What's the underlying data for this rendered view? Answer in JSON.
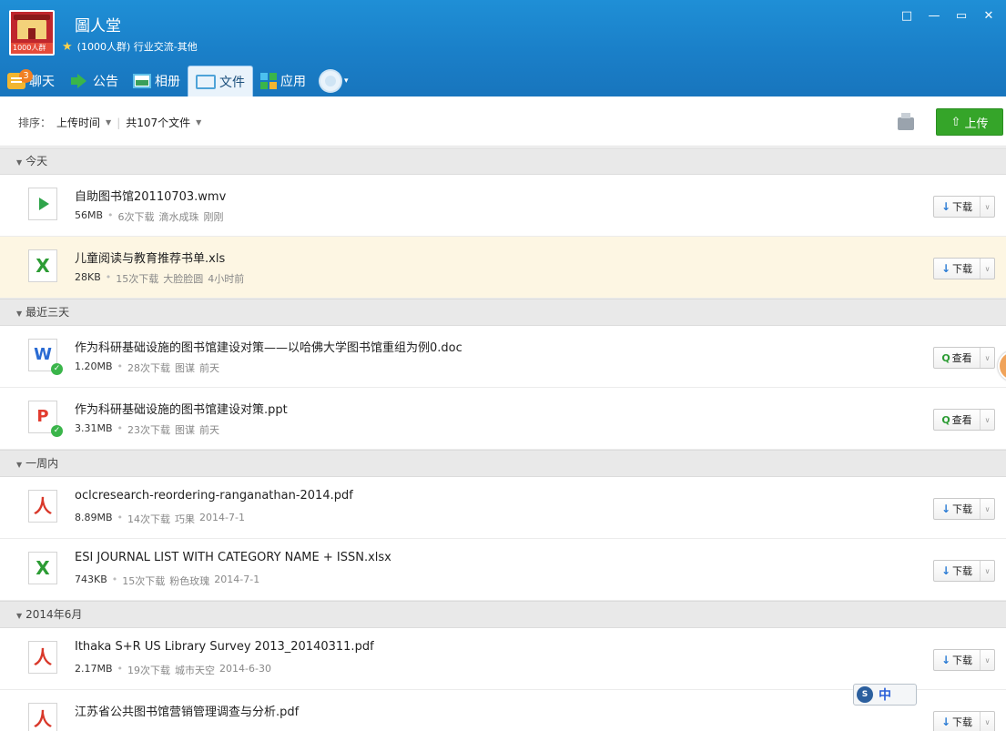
{
  "header": {
    "group_name": "圖人堂",
    "logo_tag": "1000人群",
    "group_sub": "(1000人群) 行业交流-其他",
    "window_controls": [
      "□",
      "—",
      "▭",
      "✕"
    ]
  },
  "tabs": [
    {
      "label": "聊天",
      "badge": "3",
      "icon": "chat-icon"
    },
    {
      "label": "公告",
      "icon": "notice-icon"
    },
    {
      "label": "相册",
      "icon": "album-icon"
    },
    {
      "label": "文件",
      "icon": "folder-icon",
      "active": true
    },
    {
      "label": "应用",
      "icon": "apps-icon"
    }
  ],
  "toolbar": {
    "sort_label": "排序：",
    "sort_value": "上传时间",
    "count_label": "共107个文件",
    "upload_label": "上传"
  },
  "sections": [
    {
      "title": "今天",
      "files": [
        {
          "name": "自助图书馆20110703.wmv",
          "size": "56MB",
          "downloads": "6次下载",
          "uploader": "滴水成珠",
          "time": "刚刚",
          "type": "video",
          "action": "下载"
        },
        {
          "name": "儿童阅读与教育推荐书单.xls",
          "size": "28KB",
          "downloads": "15次下载",
          "uploader": "大脸脸圆",
          "time": "4小时前",
          "type": "excel",
          "action": "下载"
        }
      ]
    },
    {
      "title": "最近三天",
      "files": [
        {
          "name": "作为科研基础设施的图书馆建设对策——以哈佛大学图书馆重组为例0.doc",
          "size": "1.20MB",
          "downloads": "28次下载",
          "uploader": "图谋",
          "time": "前天",
          "type": "word",
          "action": "查看"
        },
        {
          "name": "作为科研基础设施的图书馆建设对策.ppt",
          "size": "3.31MB",
          "downloads": "23次下载",
          "uploader": "图谋",
          "time": "前天",
          "type": "ppt",
          "action": "查看"
        }
      ]
    },
    {
      "title": "一周内",
      "files": [
        {
          "name": "oclcresearch-reordering-ranganathan-2014.pdf",
          "size": "8.89MB",
          "downloads": "14次下载",
          "uploader": "巧果",
          "time": "2014-7-1",
          "type": "pdf",
          "action": "下载"
        },
        {
          "name": "ESI JOURNAL LIST WITH CATEGORY NAME + ISSN.xlsx",
          "size": "743KB",
          "downloads": "15次下载",
          "uploader": "粉色玫瑰",
          "time": "2014-7-1",
          "type": "excel",
          "action": "下载"
        }
      ]
    },
    {
      "title": "2014年6月",
      "files": [
        {
          "name": "Ithaka S+R US Library Survey 2013_20140311.pdf",
          "size": "2.17MB",
          "downloads": "19次下载",
          "uploader": "城市天空",
          "time": "2014-6-30",
          "type": "pdf",
          "action": "下载"
        },
        {
          "name": "江苏省公共图书馆营销管理调查与分析.pdf",
          "size": "",
          "downloads": "",
          "uploader": "",
          "time": "",
          "type": "pdf",
          "action": "下载"
        }
      ]
    }
  ],
  "ime": {
    "lang": "中"
  },
  "colors": {
    "header": "#1a7fc8",
    "upload": "#35a529",
    "highlight_row": "#fdf6e3"
  }
}
